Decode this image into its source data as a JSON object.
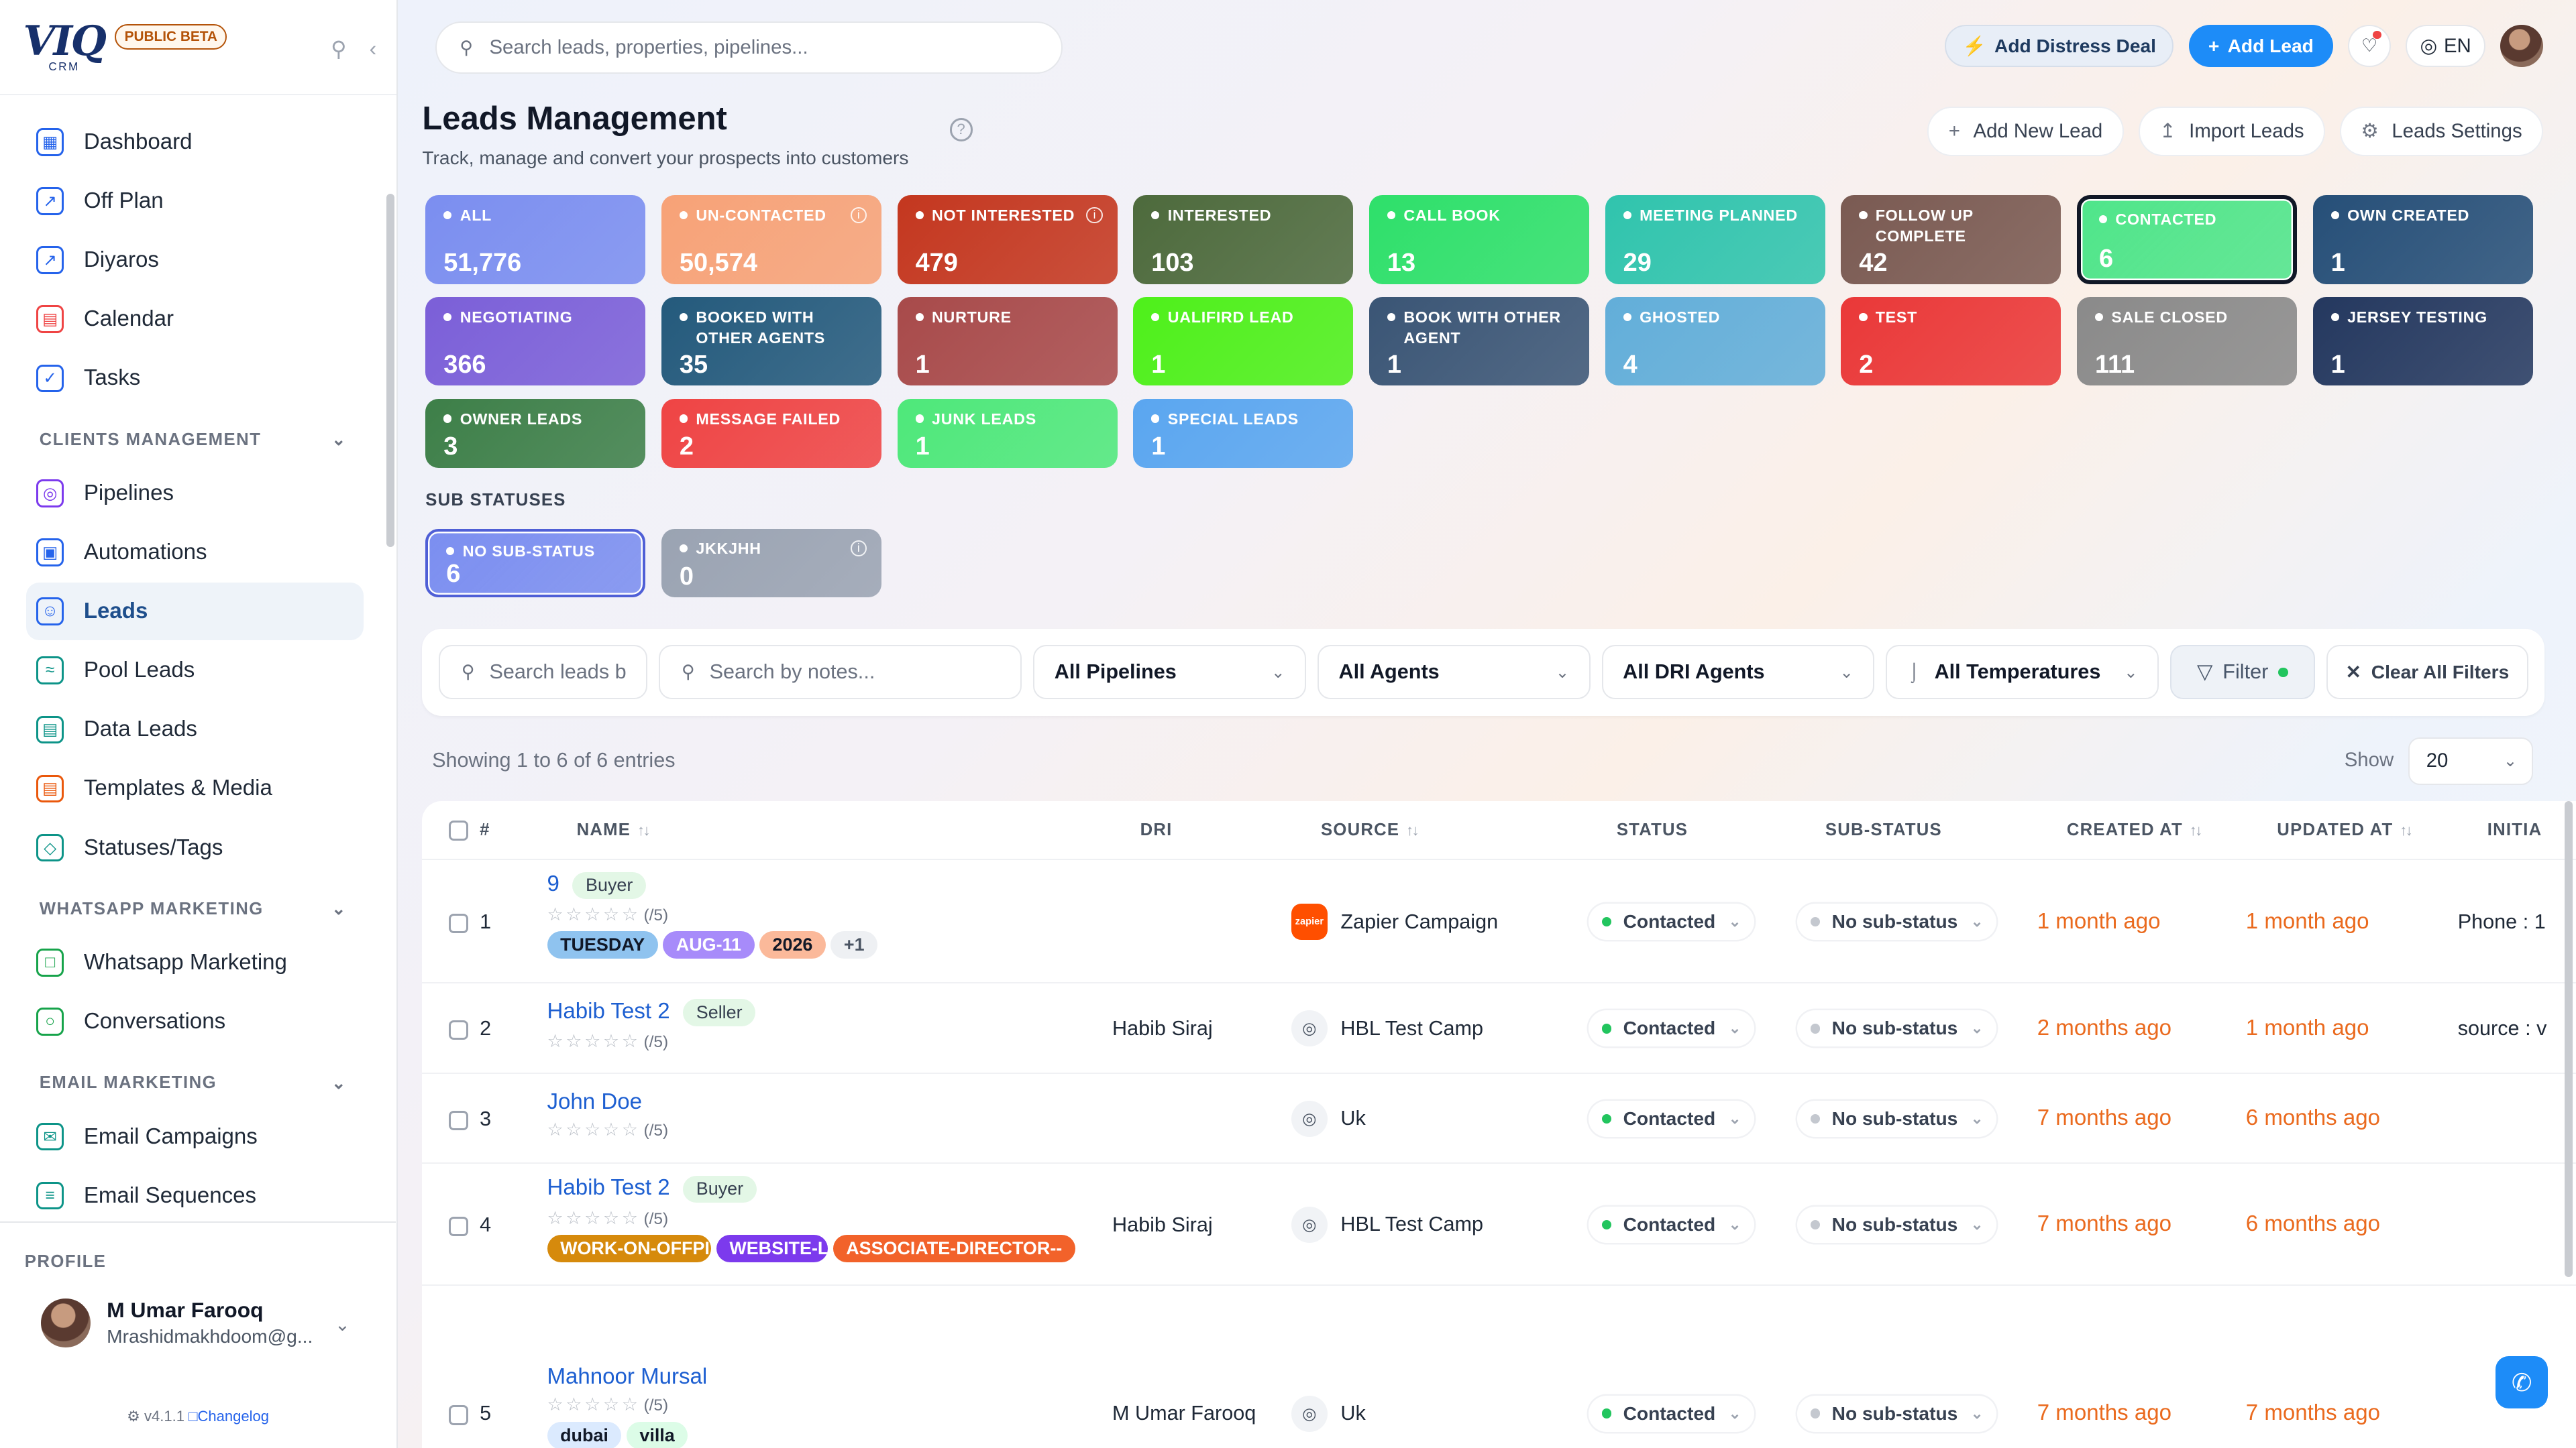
{
  "brand": {
    "logo": "VIQ",
    "logo_sub": "CRM",
    "beta": "PUBLIC BETA"
  },
  "sidebar": {
    "top_items": [
      {
        "label": "Dashboard",
        "icon": "dashboard-icon",
        "color": "#2563eb"
      },
      {
        "label": "Off Plan",
        "icon": "external-link-icon",
        "color": "#2563eb"
      },
      {
        "label": "Diyaros",
        "icon": "external-link-icon",
        "color": "#2563eb"
      },
      {
        "label": "Calendar",
        "icon": "calendar-icon",
        "color": "#ef4444"
      },
      {
        "label": "Tasks",
        "icon": "tasks-icon",
        "color": "#2563eb"
      }
    ],
    "sections": [
      {
        "title": "CLIENTS MANAGEMENT",
        "items": [
          {
            "label": "Pipelines",
            "icon": "pipeline-icon",
            "color": "#7c3aed"
          },
          {
            "label": "Automations",
            "icon": "robot-icon",
            "color": "#2563eb"
          },
          {
            "label": "Leads",
            "icon": "users-icon",
            "color": "#2563eb",
            "active": true
          },
          {
            "label": "Pool Leads",
            "icon": "pool-icon",
            "color": "#0d9488"
          },
          {
            "label": "Data Leads",
            "icon": "database-icon",
            "color": "#0d9488"
          },
          {
            "label": "Templates & Media",
            "icon": "template-icon",
            "color": "#ea580c"
          },
          {
            "label": "Statuses/Tags",
            "icon": "tag-icon",
            "color": "#0d9488"
          }
        ]
      },
      {
        "title": "WHATSAPP MARKETING",
        "items": [
          {
            "label": "Whatsapp Marketing",
            "icon": "chat-icon",
            "color": "#16a34a"
          },
          {
            "label": "Conversations",
            "icon": "message-circle-icon",
            "color": "#16a34a"
          }
        ]
      },
      {
        "title": "EMAIL MARKETING",
        "items": [
          {
            "label": "Email Campaigns",
            "icon": "mail-icon",
            "color": "#0d9488"
          },
          {
            "label": "Email Sequences",
            "icon": "layers-icon",
            "color": "#0d9488"
          }
        ]
      }
    ],
    "profile": {
      "heading": "PROFILE",
      "name": "M Umar Farooq",
      "email": "Mrashidmakhdoom@g..."
    },
    "version": "v4.1.1",
    "changelog": "Changelog"
  },
  "topbar": {
    "search_placeholder": "Search leads, properties, pipelines...",
    "distress_label": "Add Distress Deal",
    "add_lead_label": "Add Lead",
    "lang": "EN"
  },
  "page": {
    "title": "Leads Management",
    "subtitle": "Track, manage and convert your prospects into customers",
    "actions": [
      "Add New Lead",
      "Import Leads",
      "Leads Settings"
    ]
  },
  "statuses": [
    {
      "label": "ALL",
      "value": "51,776",
      "color": "#7b8ef0"
    },
    {
      "label": "UN-CONTACTED",
      "value": "50,574",
      "color": "#f7a277",
      "info": true
    },
    {
      "label": "NOT INTERESTED",
      "value": "479",
      "color": "#c4371f",
      "info": true
    },
    {
      "label": "INTERESTED",
      "value": "103",
      "color": "#4d6a3c"
    },
    {
      "label": "CALL BOOK",
      "value": "13",
      "color": "#2ee06a"
    },
    {
      "label": "MEETING PLANNED",
      "value": "29",
      "color": "#30c4ad"
    },
    {
      "label": "FOLLOW UP COMPLETE",
      "value": "42",
      "color": "#7a5a52"
    },
    {
      "label": "CONTACTED",
      "value": "6",
      "color": "#4fe58a",
      "selected": true
    },
    {
      "label": "OWN CREATED",
      "value": "1",
      "color": "#264f78"
    },
    {
      "label": "NEGOTIATING",
      "value": "366",
      "color": "#7b5fd8"
    },
    {
      "label": "BOOKED WITH OTHER AGENTS",
      "value": "35",
      "color": "#245a7c"
    },
    {
      "label": "NURTURE",
      "value": "1",
      "color": "#a84a4a"
    },
    {
      "label": "UALIFIRD LEAD",
      "value": "1",
      "color": "#4ef01a"
    },
    {
      "label": "BOOK WITH OTHER AGENT",
      "value": "1",
      "color": "#3a5575"
    },
    {
      "label": "GHOSTED",
      "value": "4",
      "color": "#62aed9"
    },
    {
      "label": "TEST",
      "value": "2",
      "color": "#ea3838"
    },
    {
      "label": "SALE CLOSED",
      "value": "111",
      "color": "#8a8a8a"
    },
    {
      "label": "JERSEY TESTING",
      "value": "1",
      "color": "#24385f"
    },
    {
      "label": "OWNER LEADS",
      "value": "3",
      "color": "#3d7f48"
    },
    {
      "label": "MESSAGE FAILED",
      "value": "2",
      "color": "#ef4444"
    },
    {
      "label": "JUNK LEADS",
      "value": "1",
      "color": "#4ee87a"
    },
    {
      "label": "SPECIAL LEADS",
      "value": "1",
      "color": "#5aa6f0"
    }
  ],
  "sub_statuses_heading": "SUB STATUSES",
  "sub_statuses": [
    {
      "label": "NO SUB-STATUS",
      "value": "6",
      "color": "#7b8ef0",
      "selected": true
    },
    {
      "label": "JKKJHH",
      "value": "0",
      "color": "#9aa3b2",
      "info": true
    }
  ],
  "filters": {
    "search_leads_placeholder": "Search leads b",
    "search_notes_placeholder": "Search by notes...",
    "pipelines": "All Pipelines",
    "agents": "All Agents",
    "dri_agents": "All DRI Agents",
    "temperatures": "All Temperatures",
    "filter_label": "Filter",
    "clear_label": "Clear All Filters"
  },
  "pagination": {
    "showing": "Showing 1 to 6 of 6 entries",
    "show_label": "Show",
    "per_page": "20"
  },
  "table": {
    "columns": [
      "#",
      "NAME",
      "DRI",
      "SOURCE",
      "STATUS",
      "SUB-STATUS",
      "CREATED AT",
      "UPDATED AT",
      "INITIA"
    ],
    "rows": [
      {
        "num": "1",
        "name": "9",
        "role": "Buyer",
        "rating": "(/5)",
        "dri": "",
        "source": "Zapier Campaign",
        "source_icon": "zapier-icon",
        "status": "Contacted",
        "sub_status": "No sub-status",
        "created": "1 month ago",
        "updated": "1 month ago",
        "initial": "Phone : 1",
        "tags": [
          {
            "t": "TUESDAY",
            "bg": "#8fc3ef",
            "fg": "#111827"
          },
          {
            "t": "AUG-11",
            "bg": "#a78bfa",
            "fg": "#ffffff"
          },
          {
            "t": "2026",
            "bg": "#fbb99a",
            "fg": "#111827"
          },
          {
            "t": "+1",
            "bg": "#eef0f3",
            "fg": "#4b5563"
          }
        ]
      },
      {
        "num": "2",
        "name": "Habib Test 2",
        "role": "Seller",
        "rating": "(/5)",
        "dri": "Habib Siraj",
        "source": "HBL Test Camp",
        "source_icon": "target-icon",
        "status": "Contacted",
        "sub_status": "No sub-status",
        "created": "2 months ago",
        "updated": "1 month ago",
        "initial": "source : v",
        "tags": []
      },
      {
        "num": "3",
        "name": "John Doe",
        "role": "",
        "rating": "(/5)",
        "dri": "",
        "source": "Uk",
        "source_icon": "target-icon",
        "status": "Contacted",
        "sub_status": "No sub-status",
        "created": "7 months ago",
        "updated": "6 months ago",
        "initial": "",
        "tags": []
      },
      {
        "num": "4",
        "name": "Habib Test 2",
        "role": "Buyer",
        "rating": "(/5)",
        "dri": "Habib Siraj",
        "source": "HBL Test Camp",
        "source_icon": "target-icon",
        "status": "Contacted",
        "sub_status": "No sub-status",
        "created": "7 months ago",
        "updated": "6 months ago",
        "initial": "",
        "tags": [
          {
            "t": "WORK-ON-OFFPI",
            "bg": "#d68a0c",
            "fg": "#ffffff"
          },
          {
            "t": "WEBSITE-L",
            "bg": "#7c3aed",
            "fg": "#ffffff"
          },
          {
            "t": "ASSOCIATE-DIRECTOR--",
            "bg": "#f2622a",
            "fg": "#ffffff"
          }
        ]
      },
      {
        "num": "5",
        "name": "Mahnoor Mursal",
        "role": "",
        "rating": "(/5)",
        "dri": "M Umar Farooq",
        "source": "Uk",
        "source_icon": "target-icon",
        "status": "Contacted",
        "sub_status": "No sub-status",
        "created": "7 months ago",
        "updated": "7 months ago",
        "initial": "",
        "tags": [
          {
            "t": "dubai",
            "bg": "#dbeafe",
            "fg": "#111827"
          },
          {
            "t": "villa",
            "bg": "#dcfce7",
            "fg": "#111827"
          }
        ]
      }
    ]
  }
}
